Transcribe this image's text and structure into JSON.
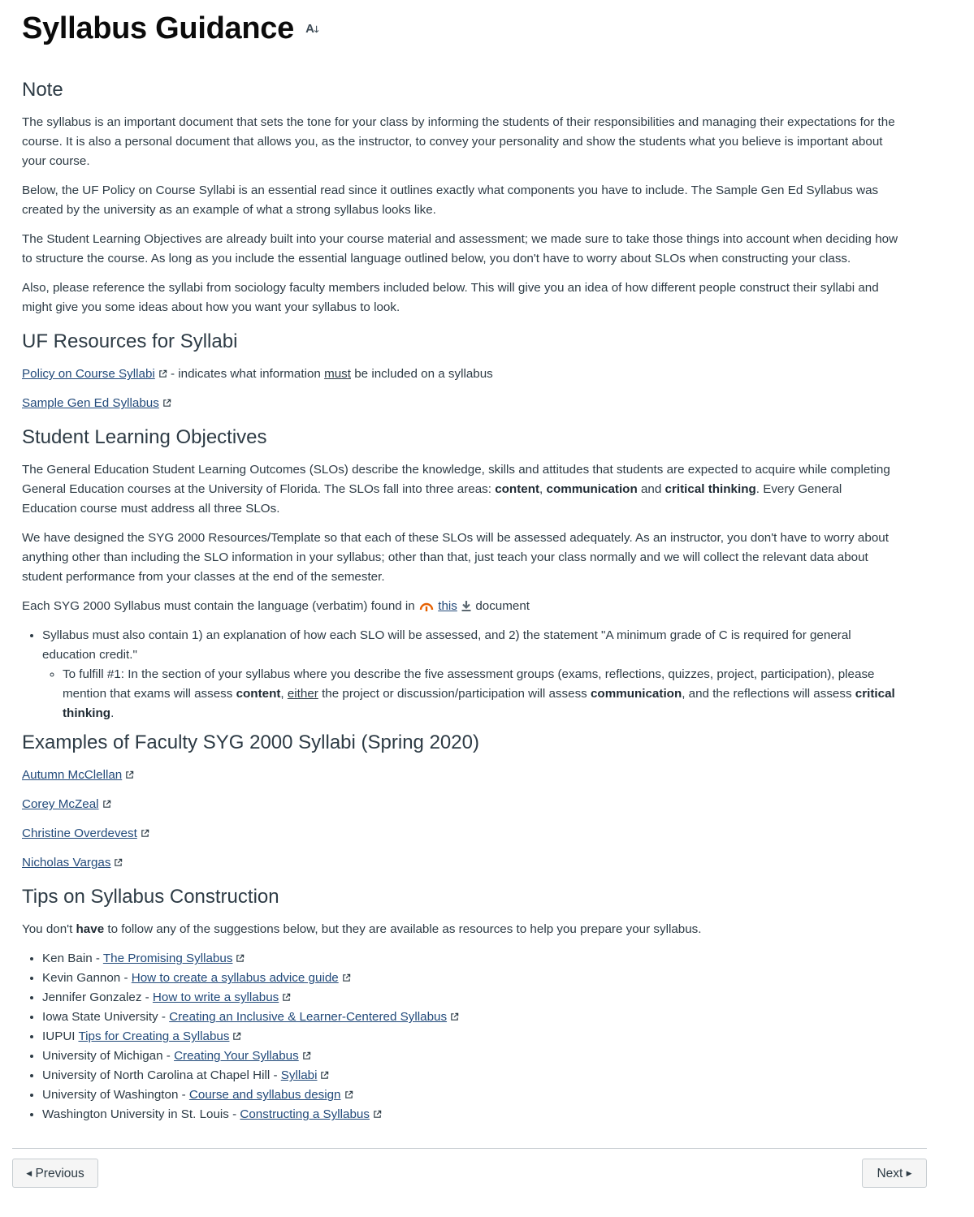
{
  "page": {
    "title": "Syllabus Guidance",
    "title_icon": "text-direction-icon"
  },
  "note": {
    "heading": "Note",
    "paragraphs": [
      "The syllabus is an important document that sets the tone for your class by informing the students of their responsibilities and managing their expectations for the course. It is also a personal document that allows you, as the instructor, to convey your personality and show the students what you believe is important about your course.",
      "Below, the UF Policy on Course Syllabi is an essential read since it outlines exactly what components you have to include. The Sample Gen Ed Syllabus was created by the university as an example of what a strong syllabus looks like.",
      "The Student Learning Objectives are already built into your course material and assessment; we made sure to take those things into account when deciding how to structure the course. As long as you include the essential language outlined below, you don't have to worry about SLOs when constructing your class.",
      "Also, please reference the syllabi from sociology faculty members included below. This will give you an idea of how different people construct their syllabi and might give you some ideas about how you want your syllabus to look."
    ]
  },
  "uf_resources": {
    "heading": "UF Resources for Syllabi",
    "policy_link": "Policy on Course Syllabi",
    "policy_desc_pre": " - indicates what information ",
    "policy_desc_must": "must",
    "policy_desc_post": " be included on a syllabus",
    "sample_link": "Sample Gen Ed Syllabus"
  },
  "slo": {
    "heading": "Student Learning Objectives",
    "p1_pre": "The General Education Student Learning Outcomes (SLOs) describe the knowledge, skills and attitudes that students are expected to acquire while completing General Education courses at the University of Florida. The SLOs fall into three areas: ",
    "p1_content": "content",
    "p1_comma": ", ",
    "p1_communication": "communication",
    "p1_and": " and ",
    "p1_critical": "critical thinking",
    "p1_post": ". Every General Education course must address all three SLOs.",
    "p2": "We have designed the SYG 2000 Resources/Template so that each of these SLOs will be assessed adequately. As an instructor, you don't have to worry about anything other than including the SLO information in your syllabus; other than that, just teach your class normally and we will collect the relevant data about student performance from your classes at the end of the semester.",
    "p3_pre": "Each SYG 2000 Syllabus must contain the language (verbatim) found in ",
    "p3_link": "this",
    "p3_post": " document",
    "bullet1": "Syllabus must also contain 1) an explanation of how each SLO will be assessed, and 2) the statement \"A minimum grade of C is required for general education credit.\"",
    "sub_pre": "To fulfill #1: In the section of your syllabus where you describe the five assessment groups (exams, reflections, quizzes, project, participation), please mention that exams will assess ",
    "sub_content": "content",
    "sub_comma": ", ",
    "sub_either": "either",
    "sub_mid": " the project or discussion/participation will assess ",
    "sub_communication": "communication",
    "sub_mid2": ", and the reflections will assess ",
    "sub_critical": "critical thinking",
    "sub_end": "."
  },
  "examples": {
    "heading": "Examples of Faculty SYG 2000 Syllabi (Spring 2020)",
    "links": [
      "Autumn McClellan",
      "Corey McZeal",
      "Christine Overdevest",
      "Nicholas Vargas"
    ]
  },
  "tips": {
    "heading": "Tips on Syllabus Construction",
    "intro_pre": "You don't ",
    "intro_bold": "have",
    "intro_post": " to follow any of the suggestions below, but they are available as resources to help you prepare your syllabus.",
    "items": [
      {
        "source": "Ken Bain - ",
        "link": "The Promising Syllabus"
      },
      {
        "source": "Kevin Gannon - ",
        "link": "How to create a syllabus advice guide"
      },
      {
        "source": "Jennifer Gonzalez - ",
        "link": "How to write a syllabus"
      },
      {
        "source": "Iowa State University - ",
        "link": "Creating an Inclusive & Learner-Centered Syllabus"
      },
      {
        "source": "IUPUI ",
        "link": "Tips for Creating a Syllabus"
      },
      {
        "source": "University of Michigan - ",
        "link": "Creating Your Syllabus"
      },
      {
        "source": "University of North Carolina at Chapel Hill - ",
        "link": "Syllabi"
      },
      {
        "source": "University of Washington - ",
        "link": "Course and syllabus design"
      },
      {
        "source": "Washington University in St. Louis - ",
        "link": "Constructing a Syllabus"
      }
    ]
  },
  "footer": {
    "previous_label": "Previous",
    "next_label": "Next"
  },
  "colors": {
    "link": "#224a7a",
    "text": "#2d3b45",
    "accent_icon": "#e66000"
  }
}
